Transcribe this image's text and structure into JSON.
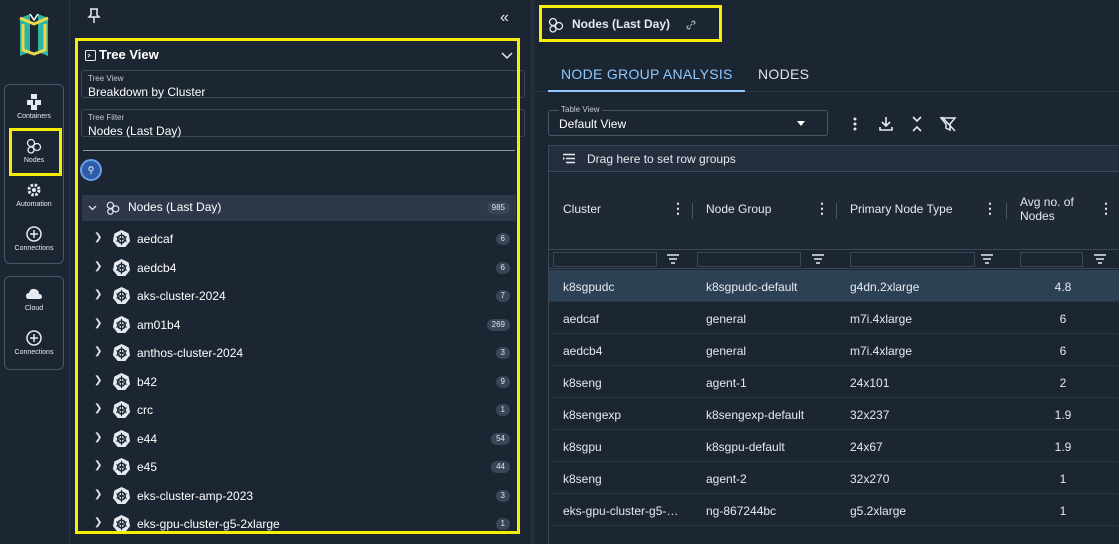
{
  "rail": {
    "group1": [
      {
        "label": "Containers",
        "icon": "containers-icon"
      },
      {
        "label": "Nodes",
        "icon": "nodes-icon"
      },
      {
        "label": "Automation",
        "icon": "gear-icon"
      },
      {
        "label": "Connections",
        "icon": "plus-circle-icon"
      }
    ],
    "group2": [
      {
        "label": "Cloud",
        "icon": "cloud-icon"
      },
      {
        "label": "Connections",
        "icon": "plus-circle-icon"
      }
    ]
  },
  "tree": {
    "title": "Tree View",
    "tree_view_field": {
      "label": "Tree View",
      "value": "Breakdown by Cluster"
    },
    "tree_filter_field": {
      "label": "Tree Filter",
      "value": "Nodes (Last Day)"
    },
    "root": {
      "label": "Nodes (Last Day)",
      "count": "985"
    },
    "items": [
      {
        "label": "aedcaf",
        "count": "6"
      },
      {
        "label": "aedcb4",
        "count": "6"
      },
      {
        "label": "aks-cluster-2024",
        "count": "7"
      },
      {
        "label": "am01b4",
        "count": "269"
      },
      {
        "label": "anthos-cluster-2024",
        "count": "3"
      },
      {
        "label": "b42",
        "count": "9"
      },
      {
        "label": "crc",
        "count": "1"
      },
      {
        "label": "e44",
        "count": "54"
      },
      {
        "label": "e45",
        "count": "44"
      },
      {
        "label": "eks-cluster-amp-2023",
        "count": "3"
      },
      {
        "label": "eks-gpu-cluster-g5-2xlarge",
        "count": "1"
      }
    ]
  },
  "main": {
    "title": "Nodes (Last Day)",
    "tabs": [
      {
        "label": "NODE GROUP ANALYSIS",
        "active": true
      },
      {
        "label": "NODES",
        "active": false
      }
    ],
    "table_view": {
      "label": "Table View",
      "value": "Default View"
    },
    "drag_hint": "Drag here to set row groups",
    "columns": [
      "Cluster",
      "Node Group",
      "Primary Node Type",
      "Avg no. of Nodes"
    ],
    "rows": [
      {
        "cluster": "k8sgpudc",
        "node_group": "k8sgpudc-default",
        "node_type": "g4dn.2xlarge",
        "avg_nodes": "4.8",
        "selected": true
      },
      {
        "cluster": "aedcaf",
        "node_group": "general",
        "node_type": "m7i.4xlarge",
        "avg_nodes": "6"
      },
      {
        "cluster": "aedcb4",
        "node_group": "general",
        "node_type": "m7i.4xlarge",
        "avg_nodes": "6"
      },
      {
        "cluster": "k8seng",
        "node_group": "agent-1",
        "node_type": "24x101",
        "avg_nodes": "2"
      },
      {
        "cluster": "k8sengexp",
        "node_group": "k8sengexp-default",
        "node_type": "32x237",
        "avg_nodes": "1.9"
      },
      {
        "cluster": "k8sgpu",
        "node_group": "k8sgpu-default",
        "node_type": "24x67",
        "avg_nodes": "1.9"
      },
      {
        "cluster": "k8seng",
        "node_group": "agent-2",
        "node_type": "32x270",
        "avg_nodes": "1"
      },
      {
        "cluster": "eks-gpu-cluster-g5-…",
        "node_group": "ng-867244bc",
        "node_type": "g5.2xlarge",
        "avg_nodes": "1"
      }
    ]
  },
  "colors": {
    "highlight": "#f5ee00",
    "accent": "#8ec9ff",
    "bg": "#1c2532",
    "selected_row": "#2d4154"
  }
}
